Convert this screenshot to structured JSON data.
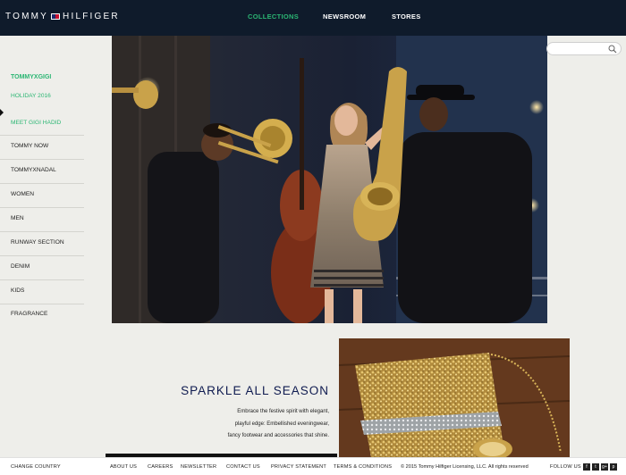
{
  "header": {
    "logo_left": "TOMMY",
    "logo_right": "HILFIGER",
    "nav": [
      {
        "label": "COLLECTIONS",
        "active": true
      },
      {
        "label": "NEWSROOM",
        "active": false
      },
      {
        "label": "STORES",
        "active": false
      }
    ]
  },
  "sidebar": {
    "items": [
      {
        "label": "TOMMYXGIGI"
      },
      {
        "label": "HOLIDAY 2016"
      },
      {
        "label": "MEET GIGI HADID"
      },
      {
        "label": "TOMMY NOW"
      },
      {
        "label": "TOMMYXNADAL"
      },
      {
        "label": "WOMEN"
      },
      {
        "label": "MEN"
      },
      {
        "label": "RUNWAY SECTION"
      },
      {
        "label": "DENIM"
      },
      {
        "label": "KIDS"
      },
      {
        "label": "FRAGRANCE"
      }
    ]
  },
  "search": {
    "placeholder": "",
    "icon": "search-icon"
  },
  "promo": {
    "title": "SPARKLE ALL SEASON",
    "line1": "Embrace the festive spirit with elegant,",
    "line2": "playful edge: Embellished eveningwear,",
    "line3": "fancy footwear and accessories that shine."
  },
  "footer": {
    "change_country": "CHANGE COUNTRY",
    "links": [
      "ABOUT US",
      "CAREERS",
      "NEWSLETTER",
      "CONTACT US",
      "PRIVACY STATEMENT",
      "TERMS & CONDITIONS"
    ],
    "copyright": "© 2015 Tommy Hilfiger Licensing, LLC. All rights reserved",
    "follow_us": "FOLLOW US",
    "social": [
      "f",
      "t",
      "g+",
      "p"
    ]
  },
  "colors": {
    "navy": "#0f1b2b",
    "green": "#2bb673",
    "title_blue": "#0f1b50"
  }
}
